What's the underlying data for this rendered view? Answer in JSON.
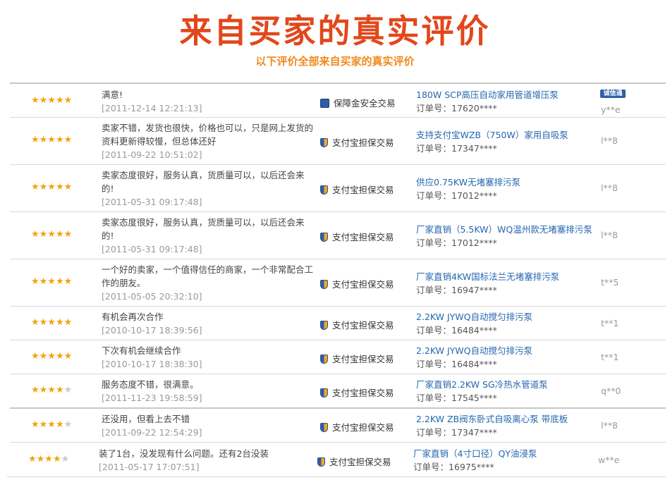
{
  "header": {
    "title": "来自买家的真实评价",
    "subtitle": "以下评价全部来自买家的真实评价"
  },
  "colors": {
    "title": "#e2471c",
    "subtitle": "#f08a1d",
    "link": "#2467b0",
    "star": "#f2a30f"
  },
  "icons": {
    "full_star": "star-icon",
    "empty_star": "star-empty-icon",
    "trade": "shield-icon",
    "credit": "credit-badge-icon"
  },
  "reviews": [
    {
      "rating": 5,
      "stars": "★★★★★",
      "stars_off": "",
      "comment": "满意!",
      "date": "[2011-12-14 12:21:13]",
      "trade": "保障金安全交易",
      "product": "180W SCP高压自动家用管道增压泵",
      "order": "订单号：17620****",
      "buyer": "y**e",
      "badge": "诚信通"
    },
    {
      "rating": 5,
      "stars": "★★★★★",
      "stars_off": "",
      "comment": "卖家不错，发货也很快，价格也可以，只是网上发货的资料更新得较慢，但总体还好",
      "date": "[2011-09-22 10:51:02]",
      "trade": "支付宝担保交易",
      "product": "支持支付宝WZB（750W）家用自吸泵",
      "order": "订单号：17347****",
      "buyer": "l**8"
    },
    {
      "rating": 5,
      "stars": "★★★★★",
      "stars_off": "",
      "comment": "卖家态度很好，服务认真，货质量可以，以后还会来的!",
      "date": "[2011-05-31 09:17:48]",
      "trade": "支付宝担保交易",
      "product": "供应0.75KW无堵塞排污泵",
      "order": "订单号：17012****",
      "buyer": "l**8"
    },
    {
      "rating": 5,
      "stars": "★★★★★",
      "stars_off": "",
      "comment": "卖家态度很好，服务认真，货质量可以，以后还会来的!",
      "date": "[2011-05-31 09:17:48]",
      "trade": "支付宝担保交易",
      "product": "厂家直销（5.5KW）WQ温州款无堵塞排污泵",
      "order": "订单号：17012****",
      "buyer": "l**8"
    },
    {
      "rating": 5,
      "stars": "★★★★★",
      "stars_off": "",
      "comment": "一个好的卖家，一个值得信任的商家，一个非常配合工作的朋友。",
      "date": "[2011-05-05 20:32:10]",
      "trade": "支付宝担保交易",
      "product": "厂家直销4KW国标法兰无堵塞排污泵",
      "order": "订单号：16947****",
      "buyer": "t**5"
    },
    {
      "rating": 5,
      "stars": "★★★★★",
      "stars_off": "",
      "comment": "有机会再次合作",
      "date": "[2010-10-17 18:39:56]",
      "trade": "支付宝担保交易",
      "product": "2.2KW JYWQ自动搅匀排污泵",
      "order": "订单号：16484****",
      "buyer": "t**1"
    },
    {
      "rating": 5,
      "stars": "★★★★★",
      "stars_off": "",
      "comment": "下次有机会继续合作",
      "date": "[2010-10-17 18:38:30]",
      "trade": "支付宝担保交易",
      "product": "2.2KW JYWQ自动搅匀排污泵",
      "order": "订单号：16484****",
      "buyer": "t**1"
    },
    {
      "rating": 4,
      "stars": "★★★★",
      "stars_off": "★",
      "comment": "服务态度不错，很满意。",
      "date": "[2011-11-23 19:58:59]",
      "trade": "支付宝担保交易",
      "product": "厂家直销2.2KW SG冷热水管道泵",
      "order": "订单号：17545****",
      "buyer": "q**0"
    },
    {
      "rating": 4,
      "stars": "★★★★",
      "stars_off": "★",
      "comment": "还没用，但看上去不错",
      "date": "[2011-09-22 12:54:29]",
      "trade": "支付宝担保交易",
      "product": "2.2KW ZB阀东卧式自吸离心泵 带底板",
      "order": "订单号：17347****",
      "buyer": "l**8"
    },
    {
      "rating": 4,
      "stars": "★★★★",
      "stars_off": "★",
      "comment": "装了1台，没发现有什么问题。还有2台没装",
      "date": "[2011-05-17 17:07:51]",
      "trade": "支付宝担保交易",
      "product": "厂家直销（4寸口径）QY油浸泵",
      "order": "订单号：16975****",
      "buyer": "w**e"
    }
  ]
}
